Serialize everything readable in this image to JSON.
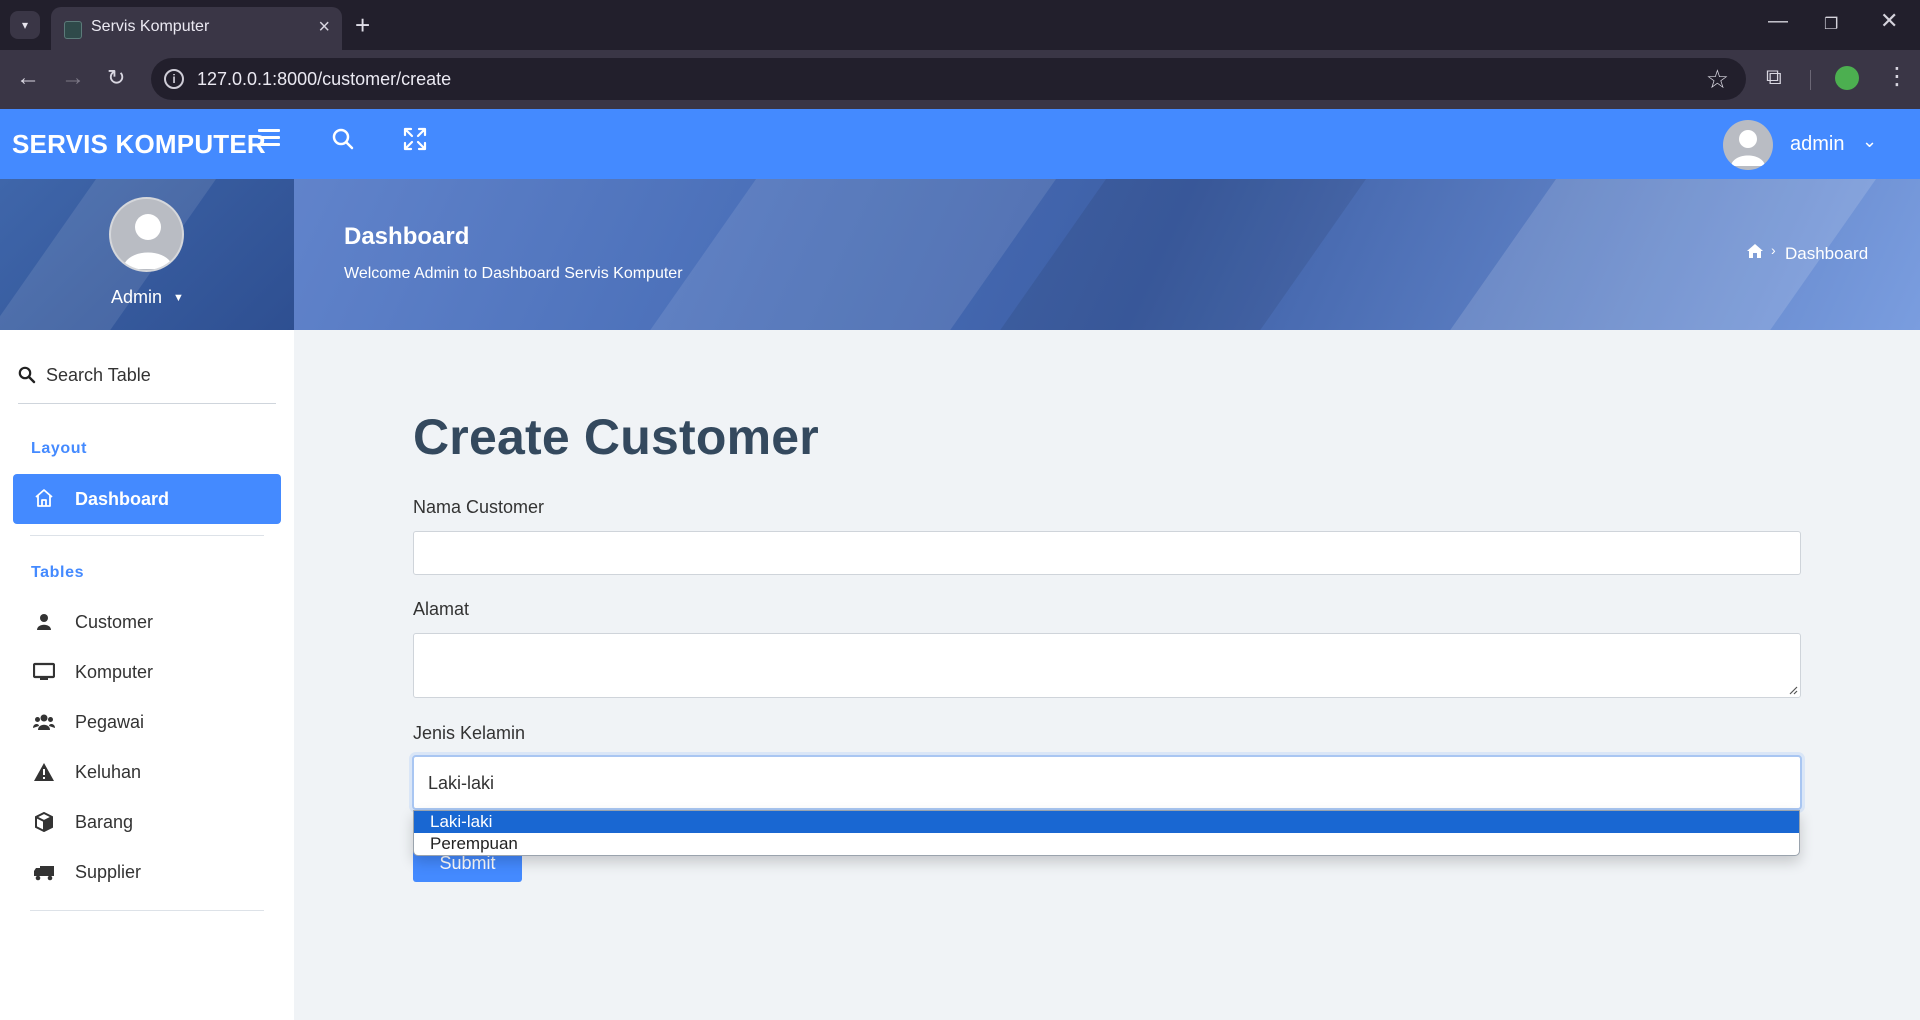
{
  "browser": {
    "tab_title": "Servis Komputer",
    "url": "127.0.0.1:8000/customer/create"
  },
  "header": {
    "brand": "SERVIS KOMPUTER",
    "user": "admin"
  },
  "hero": {
    "side_name": "Admin",
    "title": "Dashboard",
    "subtitle": "Welcome Admin to Dashboard Servis Komputer",
    "breadcrumb": "Dashboard"
  },
  "sidebar": {
    "search_placeholder": "Search Table",
    "section_layout": "Layout",
    "active_item": "Dashboard",
    "section_tables": "Tables",
    "items": [
      {
        "label": "Customer",
        "icon": "user-icon"
      },
      {
        "label": "Komputer",
        "icon": "monitor-icon"
      },
      {
        "label": "Pegawai",
        "icon": "users-icon"
      },
      {
        "label": "Keluhan",
        "icon": "warning-icon"
      },
      {
        "label": "Barang",
        "icon": "box-icon"
      },
      {
        "label": "Supplier",
        "icon": "truck-icon"
      }
    ]
  },
  "form": {
    "title": "Create Customer",
    "nama_label": "Nama Customer",
    "nama_value": "",
    "alamat_label": "Alamat",
    "alamat_value": "",
    "jk_label": "Jenis Kelamin",
    "jk_value": "Laki-laki",
    "options": [
      "Laki-laki",
      "Perempuan"
    ],
    "submit": "Submit"
  },
  "colors": {
    "primary": "#448aff",
    "selected_option": "#1967d2"
  }
}
